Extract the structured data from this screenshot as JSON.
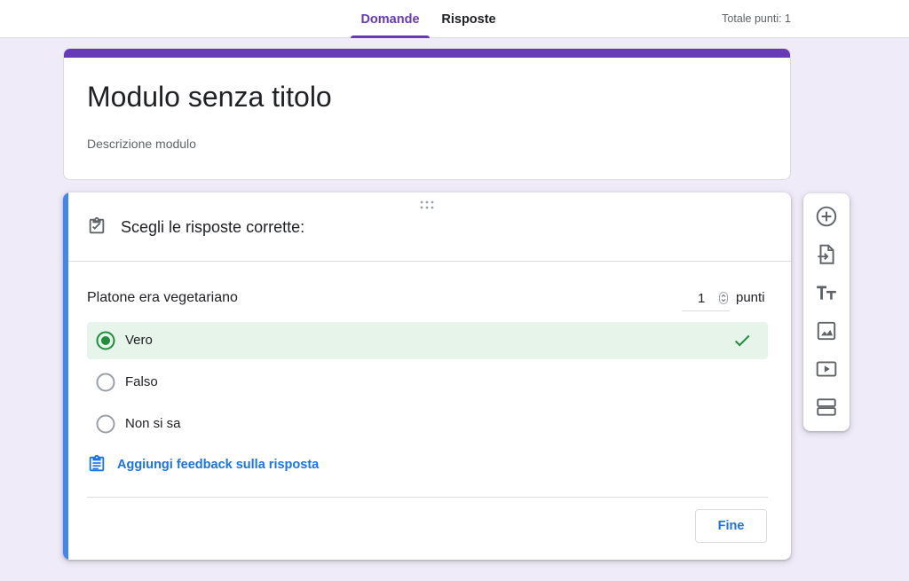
{
  "header": {
    "tabs": [
      {
        "label": "Domande",
        "active": true
      },
      {
        "label": "Risposte",
        "active": false
      }
    ],
    "total_points": "Totale punti: 1"
  },
  "form": {
    "title": "Modulo senza titolo",
    "description": "Descrizione modulo"
  },
  "question_card": {
    "header_icon": "assignment-check-icon",
    "header_text": "Scegli le risposte corrette:",
    "question": "Platone era vegetariano",
    "points_value": "1",
    "points_label": "punti",
    "options": [
      {
        "label": "Vero",
        "selected": true,
        "correct": true
      },
      {
        "label": "Falso",
        "selected": false,
        "correct": false
      },
      {
        "label": "Non si sa",
        "selected": false,
        "correct": false
      }
    ],
    "feedback_label": "Aggiungi feedback sulla risposta",
    "done_label": "Fine"
  },
  "side_toolbar": {
    "tools": [
      "add-question-icon",
      "import-questions-icon",
      "add-title-icon",
      "add-image-icon",
      "add-video-icon",
      "add-section-icon"
    ]
  },
  "colors": {
    "accent": "#673ab7",
    "background": "#f0ebf8",
    "active_card": "#4285f4",
    "correct_bg": "#e6f4ea",
    "correct_green": "#1e8e3e",
    "link_blue": "#1a73e8"
  }
}
